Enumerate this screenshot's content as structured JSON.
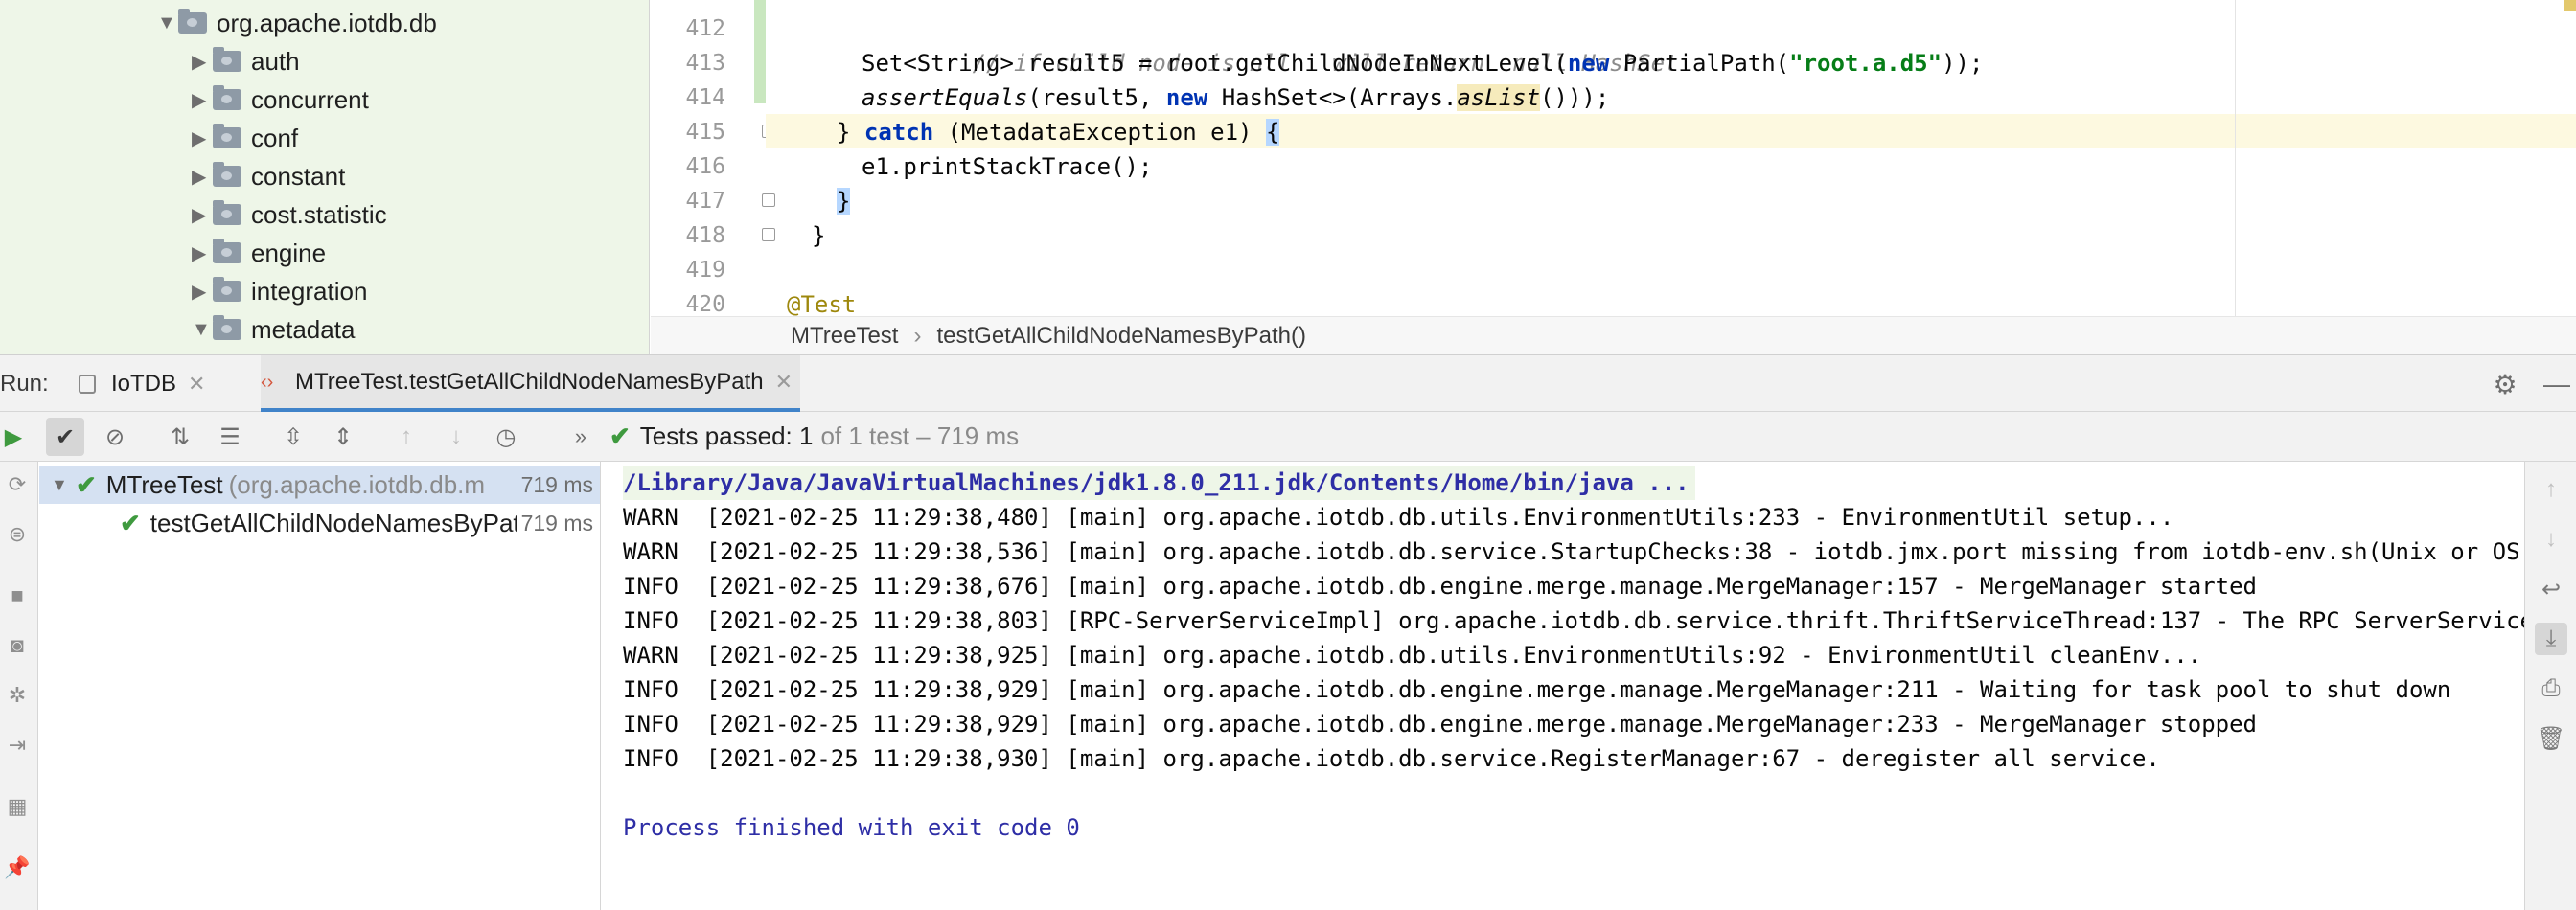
{
  "project_tree": {
    "items": [
      {
        "label": "org.apache.iotdb.db",
        "expanded": true
      },
      {
        "label": "auth",
        "expanded": false
      },
      {
        "label": "concurrent",
        "expanded": false
      },
      {
        "label": "conf",
        "expanded": false
      },
      {
        "label": "constant",
        "expanded": false
      },
      {
        "label": "cost.statistic",
        "expanded": false
      },
      {
        "label": "engine",
        "expanded": false
      },
      {
        "label": "integration",
        "expanded": false
      },
      {
        "label": "metadata",
        "expanded": true
      }
    ]
  },
  "editor": {
    "line_numbers": [
      "412",
      "413",
      "414",
      "415",
      "416",
      "417",
      "418",
      "419",
      "420"
    ],
    "current_line": "415",
    "code": {
      "l412": "// if child node is nll   will return  null HashSet",
      "l413_a": "Set<String> result5 = root.getChildNodeInNextLevel(",
      "l413_kw": "new",
      "l413_b": " PartialPath(",
      "l413_str": "\"root.a.d5\"",
      "l413_c": "));",
      "l414_a": "assertEquals",
      "l414_b": "(result5, ",
      "l414_kw": "new",
      "l414_c": " HashSet<>(Arrays.",
      "l414_d": "asList",
      "l414_e": "()));",
      "l415_a": "} ",
      "l415_kw": "catch",
      "l415_b": " (MetadataException e1) ",
      "l415_brace": "{",
      "l416": "e1.printStackTrace();",
      "l417_brace": "}",
      "l418": "}",
      "l420": "@Test"
    },
    "breadcrumb": [
      "MTreeTest",
      "testGetAllChildNodeNamesByPath()"
    ]
  },
  "run": {
    "label": "Run:",
    "tabs": [
      {
        "label": "IoTDB",
        "active": false
      },
      {
        "label": "MTreeTest.testGetAllChildNodeNamesByPath",
        "active": true
      }
    ],
    "toolbar": {
      "overflow": "»"
    },
    "status": {
      "main": "Tests passed: 1",
      "detail": "of 1 test – 719 ms"
    },
    "tests": [
      {
        "name": "MTreeTest",
        "package": "(org.apache.iotdb.db.m",
        "duration": "719 ms"
      },
      {
        "name": "testGetAllChildNodeNamesByPath",
        "package": "",
        "duration": "719 ms"
      }
    ],
    "console": {
      "command": "/Library/Java/JavaVirtualMachines/jdk1.8.0_211.jdk/Contents/Home/bin/java ...",
      "lines": [
        "WARN  [2021-02-25 11:29:38,480] [main] org.apache.iotdb.db.utils.EnvironmentUtils:233 - EnvironmentUtil setup...",
        "WARN  [2021-02-25 11:29:38,536] [main] org.apache.iotdb.db.service.StartupChecks:38 - iotdb.jmx.port missing from iotdb-env.sh(Unix or OS X, i",
        "INFO  [2021-02-25 11:29:38,676] [main] org.apache.iotdb.db.engine.merge.manage.MergeManager:157 - MergeManager started",
        "INFO  [2021-02-25 11:29:38,803] [RPC-ServerServiceImpl] org.apache.iotdb.db.service.thrift.ThriftServiceThread:137 - The RPC ServerService ser",
        "WARN  [2021-02-25 11:29:38,925] [main] org.apache.iotdb.db.utils.EnvironmentUtils:92 - EnvironmentUtil cleanEnv...",
        "INFO  [2021-02-25 11:29:38,929] [main] org.apache.iotdb.db.engine.merge.manage.MergeManager:211 - Waiting for task pool to shut down",
        "INFO  [2021-02-25 11:29:38,929] [main] org.apache.iotdb.db.engine.merge.manage.MergeManager:233 - MergeManager stopped",
        "INFO  [2021-02-25 11:29:38,930] [main] org.apache.iotdb.db.service.RegisterManager:67 - deregister all service."
      ],
      "exit": "Process finished with exit code 0"
    }
  },
  "colors": {
    "project_bg": "#eef6e8",
    "keyword": "#0033b3",
    "string": "#067d17",
    "pass_green": "#3f9a3f",
    "console_link": "#2e2ea6",
    "selection": "#d5e1f2"
  }
}
